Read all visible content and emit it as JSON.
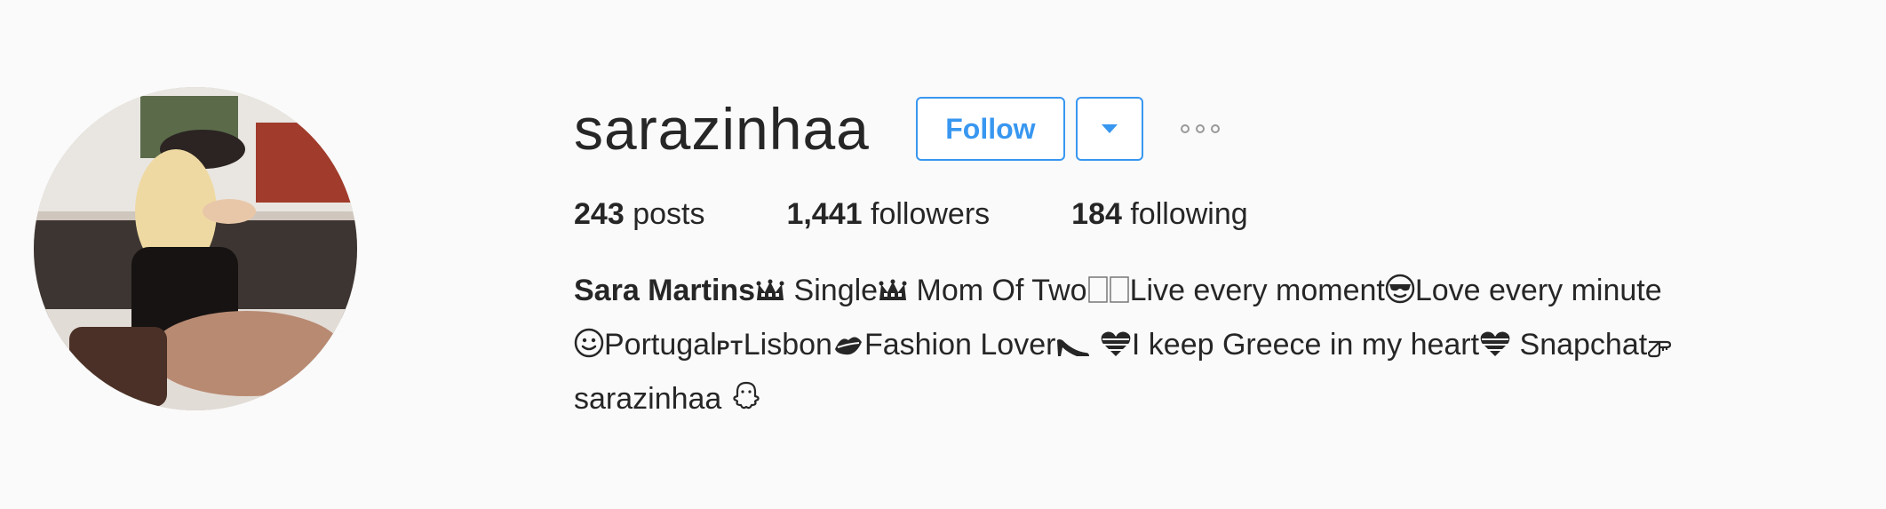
{
  "profile": {
    "username": "sarazinhaa",
    "follow_label": "Follow",
    "avatar_alt": "avatar"
  },
  "stats": {
    "posts_count": "243",
    "posts_label": "posts",
    "followers_count": "1,441",
    "followers_label": "followers",
    "following_count": "184",
    "following_label": "following"
  },
  "bio": {
    "name": "Sara Martins",
    "seg1": "Single",
    "seg2": "Mom Of Two",
    "seg3": "Live every moment",
    "seg4": "Love every minute",
    "seg5": "Portugal",
    "flag": "PT",
    "seg6": "Lisbon",
    "seg7": "Fashion Lover",
    "seg8": "I keep Greece in my heart",
    "seg9": "Snapchat",
    "seg10": "sarazinhaa"
  },
  "icons": {
    "crown": "crown-icon",
    "missing_glyph": "missing-glyph-icon",
    "sunglasses": "sunglasses-face-icon",
    "smile": "smile-face-icon",
    "lips": "lips-icon",
    "heel": "high-heel-icon",
    "heart": "striped-heart-icon",
    "pointing": "pointing-hand-icon",
    "ghost": "ghost-icon"
  },
  "colors": {
    "accent": "#3897f0",
    "text": "#262626",
    "background": "#fafafa"
  }
}
